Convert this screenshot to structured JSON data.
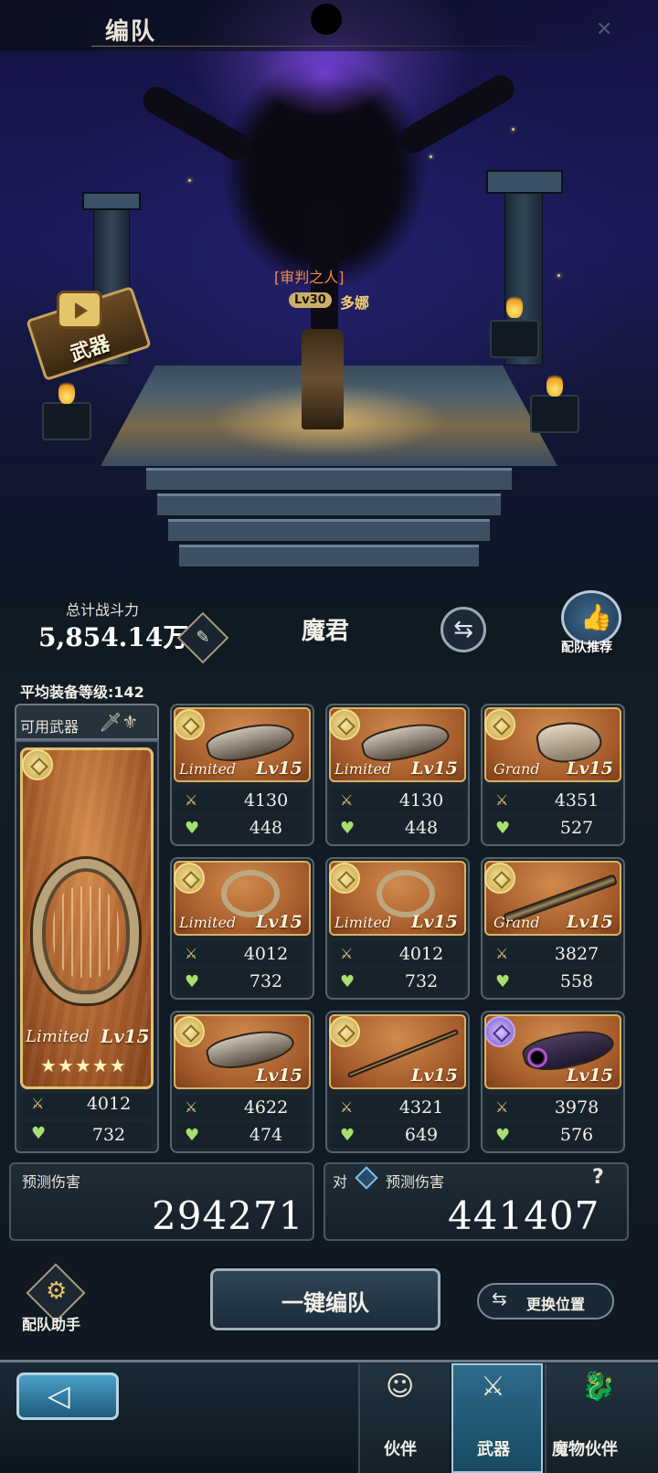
{
  "header": {
    "title": "编队"
  },
  "character": {
    "title": "[审判之人]",
    "level": "Lv30",
    "name": "多娜"
  },
  "weapon_badge": {
    "label": "武器",
    "icon": "tv-play-icon"
  },
  "power": {
    "label": "总计战斗力",
    "value": "5,854.14万"
  },
  "boss": {
    "name": "魔君"
  },
  "recommend": {
    "label": "配队推荐"
  },
  "avg_level": "平均装备等级:142",
  "usable": {
    "label": "可用武器"
  },
  "featured": {
    "rarity": "Limited",
    "level": "Lv15",
    "stars": "★★★★★",
    "atk": "4012",
    "hp": "732"
  },
  "weapons": [
    {
      "rarity": "Limited",
      "level": "Lv15",
      "atk": "4130",
      "hp": "448"
    },
    {
      "rarity": "Limited",
      "level": "Lv15",
      "atk": "4130",
      "hp": "448"
    },
    {
      "rarity": "Grand",
      "level": "Lv15",
      "atk": "4351",
      "hp": "527"
    },
    {
      "rarity": "Limited",
      "level": "Lv15",
      "atk": "4012",
      "hp": "732"
    },
    {
      "rarity": "Limited",
      "level": "Lv15",
      "atk": "4012",
      "hp": "732"
    },
    {
      "rarity": "Grand",
      "level": "Lv15",
      "atk": "3827",
      "hp": "558"
    },
    {
      "rarity": "",
      "level": "Lv15",
      "atk": "4622",
      "hp": "474"
    },
    {
      "rarity": "",
      "level": "Lv15",
      "atk": "4321",
      "hp": "649"
    },
    {
      "rarity": "",
      "level": "Lv15",
      "atk": "3978",
      "hp": "576"
    }
  ],
  "damage": {
    "predicted_label": "预测伤害",
    "predicted_value": "294271",
    "vs_prefix": "对",
    "vs_label": "预测伤害",
    "vs_value": "441407",
    "help": "?"
  },
  "actions": {
    "helper": "配队助手",
    "one_key": "一键编队",
    "swap_position": "更换位置"
  },
  "nav": {
    "companion": "伙伴",
    "weapon": "武器",
    "monster": "魔物伙伴"
  }
}
